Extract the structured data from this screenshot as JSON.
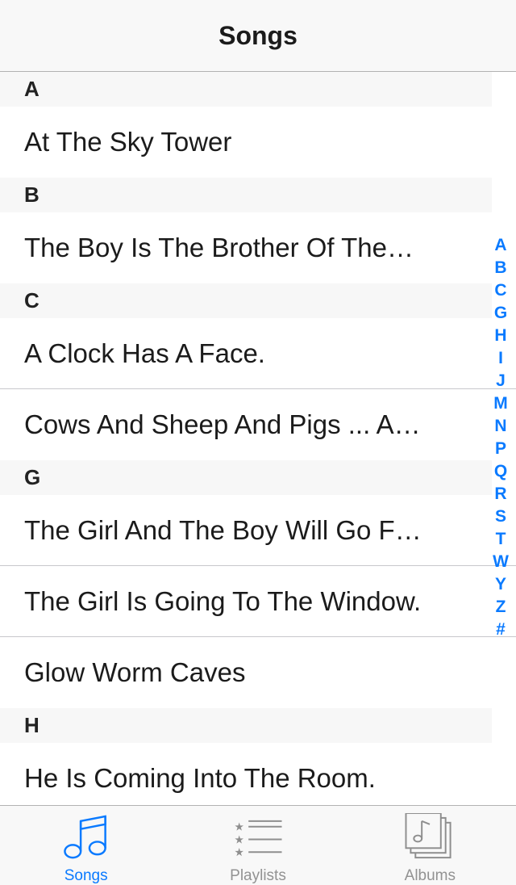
{
  "navbar": {
    "title": "Songs"
  },
  "sections": [
    {
      "header": "A",
      "rows": [
        "At The Sky Tower"
      ]
    },
    {
      "header": "B",
      "rows": [
        "The Boy Is The Brother Of The…"
      ]
    },
    {
      "header": "C",
      "rows": [
        "A Clock Has A Face.",
        "Cows And Sheep And Pigs ... A…"
      ]
    },
    {
      "header": "G",
      "rows": [
        "The Girl And The Boy Will Go F…",
        "The Girl Is Going To The Window.",
        "Glow Worm Caves"
      ]
    },
    {
      "header": "H",
      "rows": [
        "He Is Coming Into The Room."
      ]
    }
  ],
  "index_letters": [
    "A",
    "B",
    "C",
    "G",
    "H",
    "I",
    "J",
    "M",
    "N",
    "P",
    "Q",
    "R",
    "S",
    "T",
    "W",
    "Y",
    "Z",
    "#"
  ],
  "tabbar": {
    "songs": {
      "label": "Songs",
      "icon": "music-note-icon",
      "active": true
    },
    "playlists": {
      "label": "Playlists",
      "icon": "playlist-icon",
      "active": false
    },
    "albums": {
      "label": "Albums",
      "icon": "albums-icon",
      "active": false
    }
  },
  "colors": {
    "accent": "#0a7aff",
    "inactive": "#929292"
  }
}
